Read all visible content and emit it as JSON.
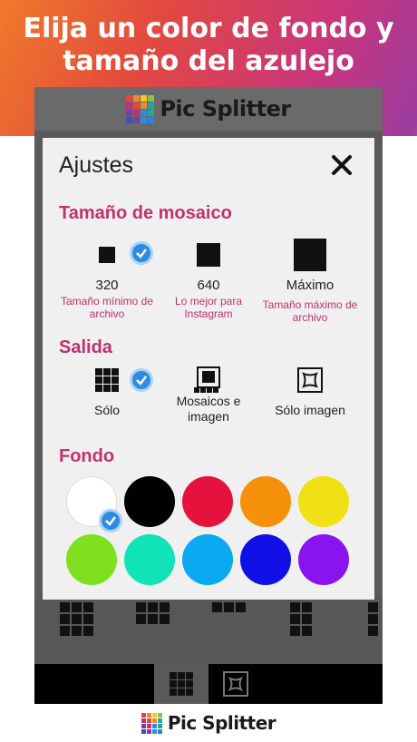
{
  "headline": {
    "line1": "Elija un color de fondo y",
    "line2": "tamaño del azulejo"
  },
  "app": {
    "title": "Pic Splitter"
  },
  "logo_colors": [
    "#e8453c",
    "#f08a2c",
    "#f5c52b",
    "#8bc34a",
    "#c2306f",
    "#e8453c",
    "#f08a2c",
    "#26a69a",
    "#7b3fa0",
    "#c2306f",
    "#2f8be0",
    "#26a69a",
    "#3f51b5",
    "#7b3fa0",
    "#2f8be0",
    "#1e88e5"
  ],
  "settings": {
    "title": "Ajustes",
    "close_icon": "close-icon",
    "tile_size": {
      "title": "Tamaño de mosaico",
      "options": [
        {
          "value": "320",
          "desc": "Tamaño mínimo de archivo",
          "selected": true
        },
        {
          "value": "640",
          "desc": "Lo mejor para Instagram",
          "selected": false
        },
        {
          "value": "Máximo",
          "desc": "Tamaño máximo de archivo",
          "selected": false
        }
      ]
    },
    "output": {
      "title": "Salida",
      "options": [
        {
          "label": "Sólo",
          "icon": "grid-icon",
          "selected": true
        },
        {
          "label": "Mosaicos e imagen",
          "icon": "tiles-and-image-icon",
          "selected": false
        },
        {
          "label": "Sólo imagen",
          "icon": "image-frame-icon",
          "selected": false
        }
      ]
    },
    "background": {
      "title": "Fondo",
      "colors": [
        "#ffffff",
        "#000000",
        "#e4123c",
        "#f5900a",
        "#f0e014",
        "#7ee020",
        "#10e3b6",
        "#0aaaf0",
        "#1010e6",
        "#8a14f0"
      ],
      "selected_index": 0
    }
  },
  "footer": {
    "brand": "Pic Splitter"
  }
}
